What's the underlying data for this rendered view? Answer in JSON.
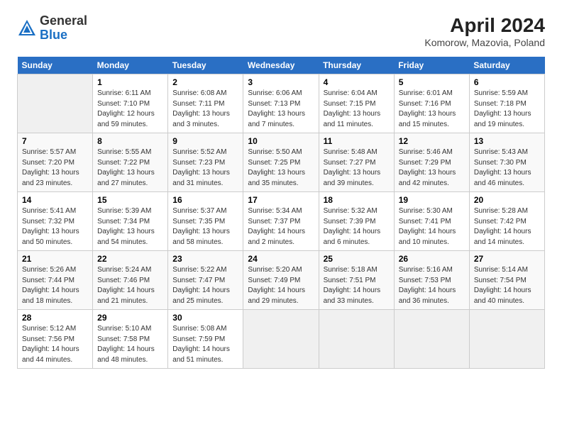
{
  "header": {
    "logo_general": "General",
    "logo_blue": "Blue",
    "title": "April 2024",
    "subtitle": "Komorow, Mazovia, Poland"
  },
  "columns": [
    "Sunday",
    "Monday",
    "Tuesday",
    "Wednesday",
    "Thursday",
    "Friday",
    "Saturday"
  ],
  "weeks": [
    [
      {
        "day": "",
        "sunrise": "",
        "sunset": "",
        "daylight": ""
      },
      {
        "day": "1",
        "sunrise": "6:11 AM",
        "sunset": "7:10 PM",
        "daylight": "12 hours and 59 minutes."
      },
      {
        "day": "2",
        "sunrise": "6:08 AM",
        "sunset": "7:11 PM",
        "daylight": "13 hours and 3 minutes."
      },
      {
        "day": "3",
        "sunrise": "6:06 AM",
        "sunset": "7:13 PM",
        "daylight": "13 hours and 7 minutes."
      },
      {
        "day": "4",
        "sunrise": "6:04 AM",
        "sunset": "7:15 PM",
        "daylight": "13 hours and 11 minutes."
      },
      {
        "day": "5",
        "sunrise": "6:01 AM",
        "sunset": "7:16 PM",
        "daylight": "13 hours and 15 minutes."
      },
      {
        "day": "6",
        "sunrise": "5:59 AM",
        "sunset": "7:18 PM",
        "daylight": "13 hours and 19 minutes."
      }
    ],
    [
      {
        "day": "7",
        "sunrise": "5:57 AM",
        "sunset": "7:20 PM",
        "daylight": "13 hours and 23 minutes."
      },
      {
        "day": "8",
        "sunrise": "5:55 AM",
        "sunset": "7:22 PM",
        "daylight": "13 hours and 27 minutes."
      },
      {
        "day": "9",
        "sunrise": "5:52 AM",
        "sunset": "7:23 PM",
        "daylight": "13 hours and 31 minutes."
      },
      {
        "day": "10",
        "sunrise": "5:50 AM",
        "sunset": "7:25 PM",
        "daylight": "13 hours and 35 minutes."
      },
      {
        "day": "11",
        "sunrise": "5:48 AM",
        "sunset": "7:27 PM",
        "daylight": "13 hours and 39 minutes."
      },
      {
        "day": "12",
        "sunrise": "5:46 AM",
        "sunset": "7:29 PM",
        "daylight": "13 hours and 42 minutes."
      },
      {
        "day": "13",
        "sunrise": "5:43 AM",
        "sunset": "7:30 PM",
        "daylight": "13 hours and 46 minutes."
      }
    ],
    [
      {
        "day": "14",
        "sunrise": "5:41 AM",
        "sunset": "7:32 PM",
        "daylight": "13 hours and 50 minutes."
      },
      {
        "day": "15",
        "sunrise": "5:39 AM",
        "sunset": "7:34 PM",
        "daylight": "13 hours and 54 minutes."
      },
      {
        "day": "16",
        "sunrise": "5:37 AM",
        "sunset": "7:35 PM",
        "daylight": "13 hours and 58 minutes."
      },
      {
        "day": "17",
        "sunrise": "5:34 AM",
        "sunset": "7:37 PM",
        "daylight": "14 hours and 2 minutes."
      },
      {
        "day": "18",
        "sunrise": "5:32 AM",
        "sunset": "7:39 PM",
        "daylight": "14 hours and 6 minutes."
      },
      {
        "day": "19",
        "sunrise": "5:30 AM",
        "sunset": "7:41 PM",
        "daylight": "14 hours and 10 minutes."
      },
      {
        "day": "20",
        "sunrise": "5:28 AM",
        "sunset": "7:42 PM",
        "daylight": "14 hours and 14 minutes."
      }
    ],
    [
      {
        "day": "21",
        "sunrise": "5:26 AM",
        "sunset": "7:44 PM",
        "daylight": "14 hours and 18 minutes."
      },
      {
        "day": "22",
        "sunrise": "5:24 AM",
        "sunset": "7:46 PM",
        "daylight": "14 hours and 21 minutes."
      },
      {
        "day": "23",
        "sunrise": "5:22 AM",
        "sunset": "7:47 PM",
        "daylight": "14 hours and 25 minutes."
      },
      {
        "day": "24",
        "sunrise": "5:20 AM",
        "sunset": "7:49 PM",
        "daylight": "14 hours and 29 minutes."
      },
      {
        "day": "25",
        "sunrise": "5:18 AM",
        "sunset": "7:51 PM",
        "daylight": "14 hours and 33 minutes."
      },
      {
        "day": "26",
        "sunrise": "5:16 AM",
        "sunset": "7:53 PM",
        "daylight": "14 hours and 36 minutes."
      },
      {
        "day": "27",
        "sunrise": "5:14 AM",
        "sunset": "7:54 PM",
        "daylight": "14 hours and 40 minutes."
      }
    ],
    [
      {
        "day": "28",
        "sunrise": "5:12 AM",
        "sunset": "7:56 PM",
        "daylight": "14 hours and 44 minutes."
      },
      {
        "day": "29",
        "sunrise": "5:10 AM",
        "sunset": "7:58 PM",
        "daylight": "14 hours and 48 minutes."
      },
      {
        "day": "30",
        "sunrise": "5:08 AM",
        "sunset": "7:59 PM",
        "daylight": "14 hours and 51 minutes."
      },
      {
        "day": "",
        "sunrise": "",
        "sunset": "",
        "daylight": ""
      },
      {
        "day": "",
        "sunrise": "",
        "sunset": "",
        "daylight": ""
      },
      {
        "day": "",
        "sunrise": "",
        "sunset": "",
        "daylight": ""
      },
      {
        "day": "",
        "sunrise": "",
        "sunset": "",
        "daylight": ""
      }
    ]
  ]
}
